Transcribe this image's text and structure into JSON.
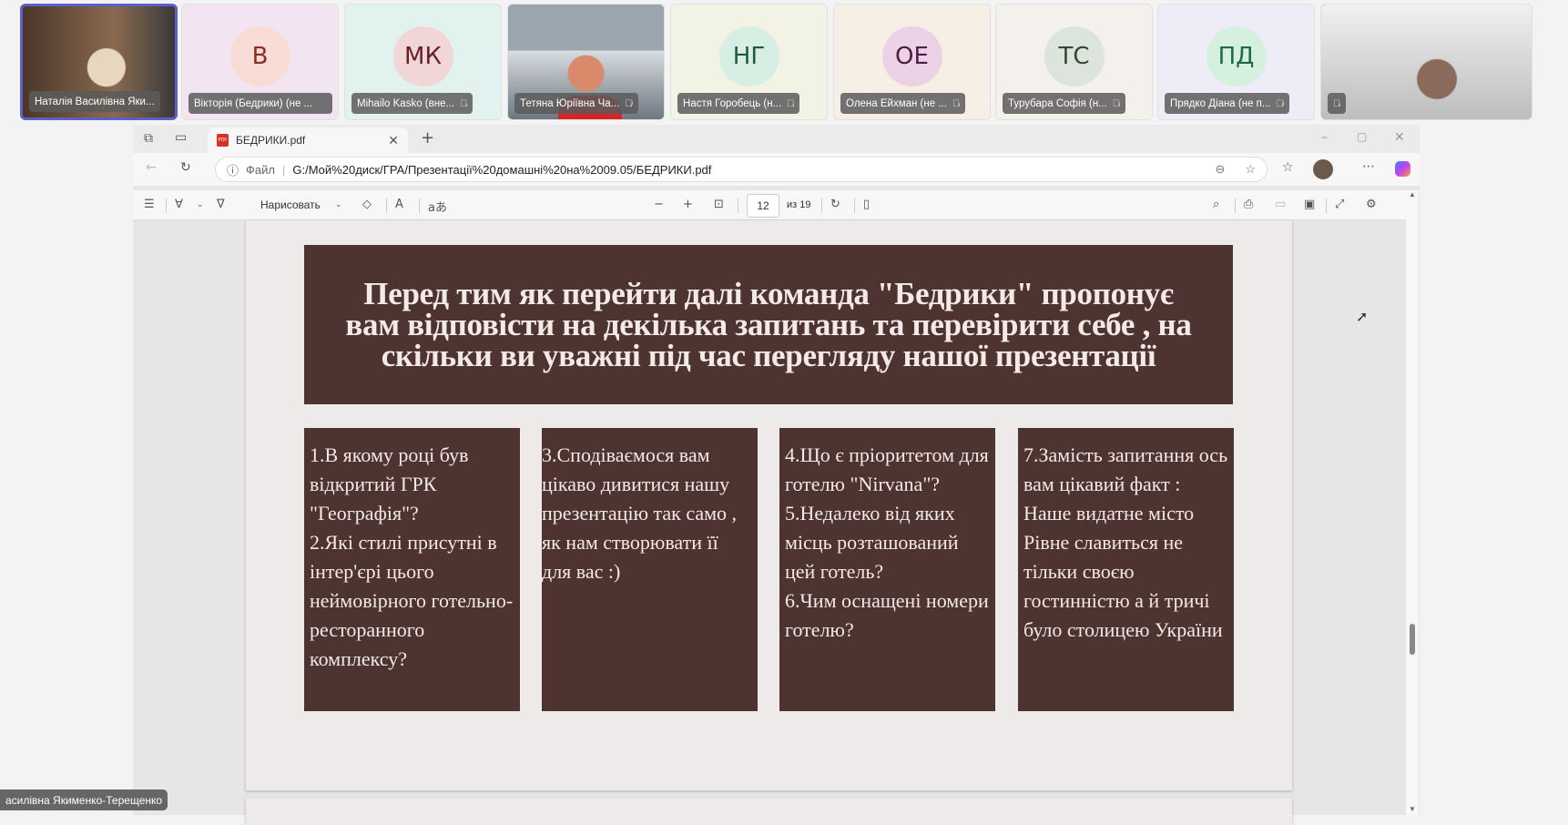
{
  "participants": [
    {
      "name": "Наталія Василівна Яки...",
      "initials": "",
      "video": true,
      "active": true,
      "bg": "#6b5040"
    },
    {
      "name": "Вікторія (Бедрики) (не ...",
      "initials": "В",
      "bg": "#f2e4f0",
      "avatar_bg": "#f9dcd6",
      "fg": "#8a2e24"
    },
    {
      "name": "Mihailo Kasko (вне...",
      "initials": "МК",
      "bg": "#e2f3ef",
      "avatar_bg": "#f1d6d8",
      "fg": "#6a1e26"
    },
    {
      "name": "Тетяна Юріївна Ча...",
      "initials": "",
      "video": true,
      "bg": "#8f9aa3"
    },
    {
      "name": "Настя Горобець (н...",
      "initials": "НГ",
      "bg": "#f2f3e4",
      "avatar_bg": "#d6eee3",
      "fg": "#1d5a3e"
    },
    {
      "name": "Олена Ейхман (не ...",
      "initials": "ОЕ",
      "bg": "#f6efe6",
      "avatar_bg": "#ecd2e6",
      "fg": "#4e1f44"
    },
    {
      "name": "Турубара Софія (н...",
      "initials": "ТС",
      "bg": "#f4f1ec",
      "avatar_bg": "#dce4dc",
      "fg": "#2e4a34"
    },
    {
      "name": "Прядко Діана (не п...",
      "initials": "ПД",
      "bg": "#eeecf6",
      "avatar_bg": "#d6f0e0",
      "fg": "#1e6b46"
    },
    {
      "name": "",
      "initials": "",
      "video": true,
      "bg": "#cfcfcf"
    }
  ],
  "browser": {
    "tab_title": "БЕДРИКИ.pdf",
    "address_label": "Файл",
    "url": "G:/Мой%20диск/ГРА/Презентації%20домашні%20на%2009.05/БЕДРИКИ.pdf",
    "draw_label": "Нарисовать",
    "page_current": "12",
    "page_total": "из 19"
  },
  "slide": {
    "title": "Перед тим як перейти далі команда \"Бедрики\" пропонує вам відповісти на декілька запитань та перевірити себе , на скільки ви уважні під час перегляду нашої презентації",
    "cards": [
      "1.В якому році був відкритий ГРК \"Географія\"?\n2.Які стилі присутні в інтер'єрі цього неймовірного готельно-ресторанного комплексу?",
      "3.Сподіваємося вам цікаво дивитися нашу презентацію так само , як нам створювати її для вас :)",
      "4.Що є пріоритетом для готелю \"Nirvana\"?\n5.Недалеко від яких місць розташований цей готель?\n6.Чим оснащені номери готелю?",
      "7.Замість запитання ось вам цікавий факт : Наше видатне місто Рівне славиться не тільки своєю гостинністю а й тричі було столицею України"
    ]
  },
  "tooltip": "асилівна Якименко-Терещенко"
}
